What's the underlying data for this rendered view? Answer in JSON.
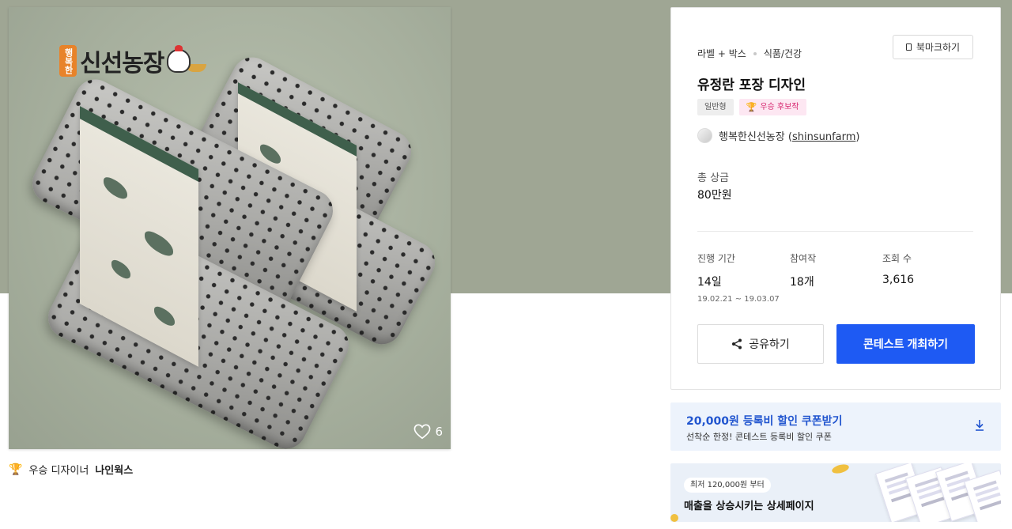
{
  "product": {
    "brand_logo_text": "신선농장",
    "brand_logo_badge": "행복한",
    "likes_count": "6"
  },
  "winner": {
    "label": "우승 디자이너",
    "name": "나인웍스"
  },
  "card": {
    "category_primary": "라벨 + 박스",
    "category_secondary": "식품/건강",
    "bookmark_label": "북마크하기",
    "title": "유정란 포장 디자인",
    "tag_type": "일반형",
    "tag_award": "우승 후보작",
    "host_name": "행복한신선농장",
    "host_handle_open": "(",
    "host_handle": "shinsunfarm",
    "host_handle_close": ")",
    "prize_label": "총 상금",
    "prize_value": "80만원",
    "stats": [
      {
        "label": "진행 기간",
        "value": "14일",
        "sub": "19.02.21 ~ 19.03.07"
      },
      {
        "label": "참여작",
        "value": "18개",
        "sub": ""
      },
      {
        "label": "조회 수",
        "value": "3,616",
        "sub": ""
      }
    ],
    "share_label": "공유하기",
    "host_contest_label": "콘테스트 개최하기"
  },
  "coupon": {
    "title": "20,000원 등록비 할인 쿠폰받기",
    "subtitle": "선착순 한정! 콘테스트 등록비 할인 쿠폰"
  },
  "ad": {
    "pill": "최저 120,000원 부터",
    "title": "매출을 상승시키는 상세페이지"
  },
  "colors": {
    "hero_band": "#9fa694",
    "primary_button": "#1e5af3",
    "coupon_title": "#2155cf",
    "award_tag_text": "#d6246e"
  }
}
